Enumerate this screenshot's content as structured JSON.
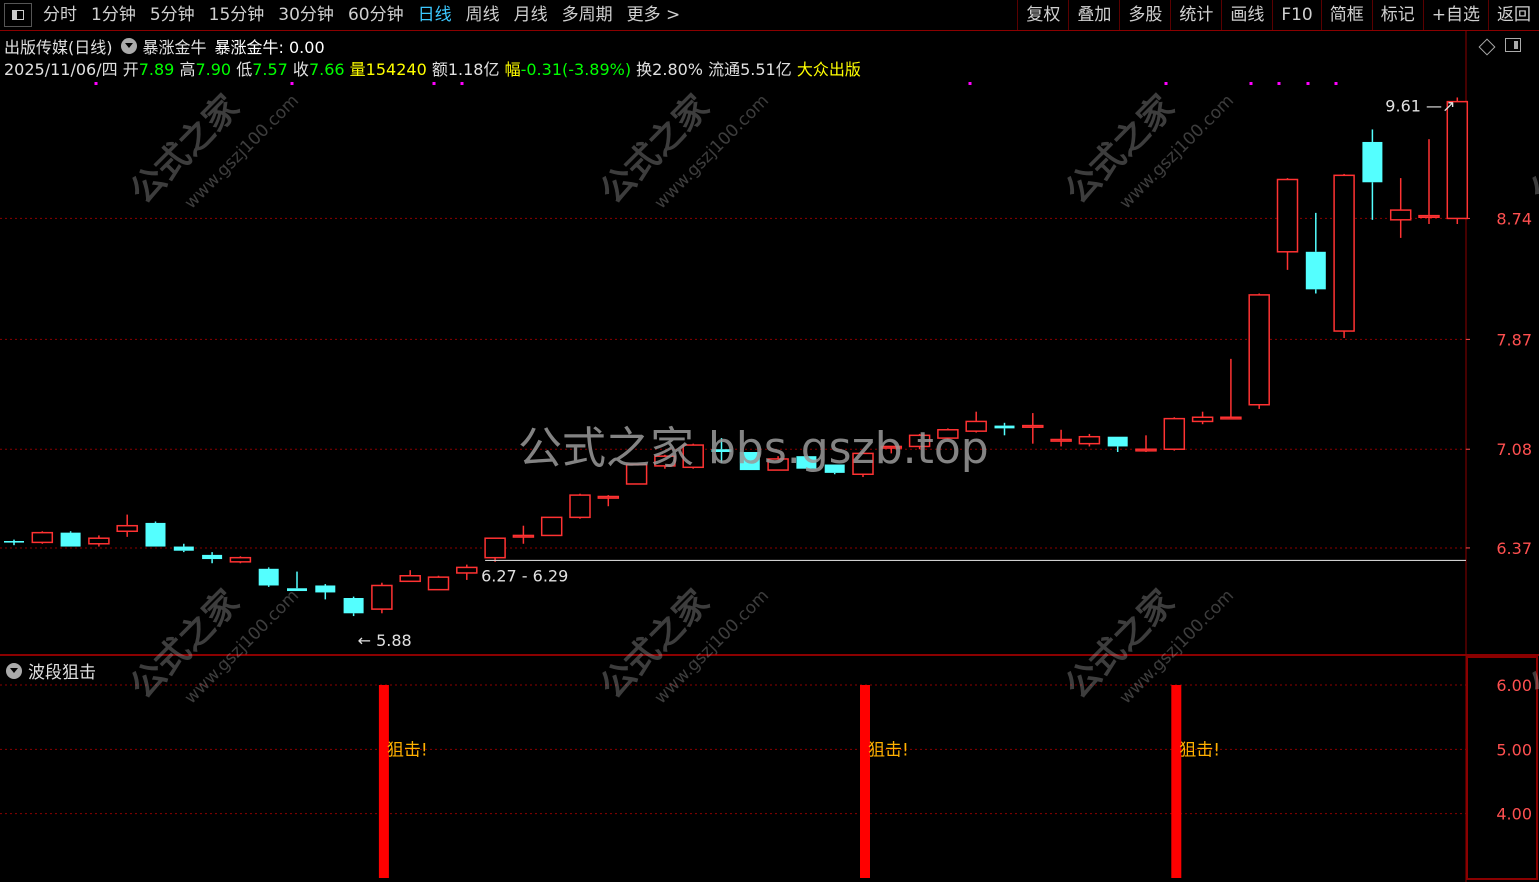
{
  "toolbar": {
    "periods": [
      "分时",
      "1分钟",
      "5分钟",
      "15分钟",
      "30分钟",
      "60分钟",
      "日线",
      "周线",
      "月线",
      "多周期",
      "更多 >"
    ],
    "active_period": "日线",
    "tools": [
      "复权",
      "叠加",
      "多股",
      "统计",
      "画线",
      "F10",
      "简框",
      "标记",
      "+自选",
      "返回"
    ]
  },
  "header": {
    "stock_title": "出版传媒(日线)",
    "indicator_name": "暴涨金牛",
    "indicator_value": "暴涨金牛: 0.00",
    "date": "2025/11/06/四",
    "open_label": "开",
    "open": "7.89",
    "high_label": "高",
    "high": "7.90",
    "low_label": "低",
    "low": "7.57",
    "close_label": "收",
    "close": "7.66",
    "vol_label": "量",
    "vol": "154240",
    "amount": "额1.18亿",
    "change_label": "幅",
    "change": "-0.31(-3.89%)",
    "turnover": "换2.80%",
    "float": "流通5.51亿",
    "sector": "大众出版"
  },
  "sub_panel": {
    "title": "波段狙击",
    "signal_text": "狙击!"
  },
  "watermark": {
    "center": "公式之家 bbs.gszb.top",
    "diag_cn": "公式之家",
    "diag_url": "www.gszj100.com"
  },
  "colors": {
    "up": "#ff3232",
    "down": "#54ffff",
    "grid": "#8b0000",
    "axis_text": "#ff5050",
    "magenta": "#ff00ff",
    "signal": "#ff0000",
    "signal_text": "#ffb000"
  },
  "chart_data": [
    {
      "type": "candlestick",
      "price_ticks": [
        8.74,
        7.87,
        7.08,
        6.37
      ],
      "ylim": [
        5.6,
        9.75
      ],
      "annotations": {
        "high": "9.61",
        "low": "5.88",
        "range_line": "6.27 - 6.29"
      },
      "candles": [
        {
          "o": 6.42,
          "h": 6.43,
          "l": 6.39,
          "c": 6.41
        },
        {
          "o": 6.41,
          "h": 6.49,
          "l": 6.4,
          "c": 6.48
        },
        {
          "o": 6.48,
          "h": 6.49,
          "l": 6.38,
          "c": 6.38
        },
        {
          "o": 6.4,
          "h": 6.46,
          "l": 6.38,
          "c": 6.44
        },
        {
          "o": 6.49,
          "h": 6.61,
          "l": 6.45,
          "c": 6.53
        },
        {
          "o": 6.55,
          "h": 6.56,
          "l": 6.38,
          "c": 6.38
        },
        {
          "o": 6.38,
          "h": 6.4,
          "l": 6.34,
          "c": 6.35
        },
        {
          "o": 6.32,
          "h": 6.34,
          "l": 6.26,
          "c": 6.29
        },
        {
          "o": 6.27,
          "h": 6.31,
          "l": 6.26,
          "c": 6.3
        },
        {
          "o": 6.22,
          "h": 6.23,
          "l": 6.09,
          "c": 6.1
        },
        {
          "o": 6.08,
          "h": 6.2,
          "l": 6.06,
          "c": 6.06
        },
        {
          "o": 6.1,
          "h": 6.11,
          "l": 6.0,
          "c": 6.05
        },
        {
          "o": 6.01,
          "h": 6.02,
          "l": 5.88,
          "c": 5.9
        },
        {
          "o": 5.93,
          "h": 6.12,
          "l": 5.9,
          "c": 6.1
        },
        {
          "o": 6.13,
          "h": 6.21,
          "l": 6.13,
          "c": 6.17
        },
        {
          "o": 6.07,
          "h": 6.17,
          "l": 6.07,
          "c": 6.16
        },
        {
          "o": 6.19,
          "h": 6.25,
          "l": 6.14,
          "c": 6.23
        },
        {
          "o": 6.3,
          "h": 6.44,
          "l": 6.27,
          "c": 6.44
        },
        {
          "o": 6.45,
          "h": 6.53,
          "l": 6.4,
          "c": 6.46
        },
        {
          "o": 6.46,
          "h": 6.59,
          "l": 6.46,
          "c": 6.59
        },
        {
          "o": 6.59,
          "h": 6.76,
          "l": 6.58,
          "c": 6.75
        },
        {
          "o": 6.73,
          "h": 6.75,
          "l": 6.67,
          "c": 6.74
        },
        {
          "o": 6.83,
          "h": 6.97,
          "l": 6.83,
          "c": 6.97
        },
        {
          "o": 6.96,
          "h": 7.04,
          "l": 6.94,
          "c": 7.03
        },
        {
          "o": 6.95,
          "h": 7.12,
          "l": 6.94,
          "c": 7.11
        },
        {
          "o": 7.08,
          "h": 7.16,
          "l": 6.98,
          "c": 7.06
        },
        {
          "o": 7.06,
          "h": 7.06,
          "l": 6.93,
          "c": 6.93
        },
        {
          "o": 6.93,
          "h": 7.03,
          "l": 6.93,
          "c": 7.01
        },
        {
          "o": 7.03,
          "h": 7.03,
          "l": 6.94,
          "c": 6.94
        },
        {
          "o": 6.97,
          "h": 6.97,
          "l": 6.9,
          "c": 6.91
        },
        {
          "o": 6.9,
          "h": 7.06,
          "l": 6.88,
          "c": 7.05
        },
        {
          "o": 7.09,
          "h": 7.1,
          "l": 7.05,
          "c": 7.1
        },
        {
          "o": 7.1,
          "h": 7.19,
          "l": 7.08,
          "c": 7.18
        },
        {
          "o": 7.16,
          "h": 7.23,
          "l": 7.15,
          "c": 7.22
        },
        {
          "o": 7.21,
          "h": 7.35,
          "l": 7.2,
          "c": 7.28
        },
        {
          "o": 7.25,
          "h": 7.27,
          "l": 7.18,
          "c": 7.23
        },
        {
          "o": 7.25,
          "h": 7.34,
          "l": 7.12,
          "c": 7.25
        },
        {
          "o": 7.15,
          "h": 7.22,
          "l": 7.1,
          "c": 7.15
        },
        {
          "o": 7.12,
          "h": 7.19,
          "l": 7.1,
          "c": 7.17
        },
        {
          "o": 7.17,
          "h": 7.17,
          "l": 7.06,
          "c": 7.1
        },
        {
          "o": 7.08,
          "h": 7.18,
          "l": 7.06,
          "c": 7.08
        },
        {
          "o": 7.08,
          "h": 7.31,
          "l": 7.07,
          "c": 7.3
        },
        {
          "o": 7.28,
          "h": 7.35,
          "l": 7.26,
          "c": 7.31
        },
        {
          "o": 7.31,
          "h": 7.73,
          "l": 7.3,
          "c": 7.31
        },
        {
          "o": 7.4,
          "h": 8.2,
          "l": 7.37,
          "c": 8.19
        },
        {
          "o": 8.5,
          "h": 9.03,
          "l": 8.37,
          "c": 9.02
        },
        {
          "o": 8.5,
          "h": 8.78,
          "l": 8.2,
          "c": 8.23
        },
        {
          "o": 7.93,
          "h": 9.06,
          "l": 7.88,
          "c": 9.05
        },
        {
          "o": 9.29,
          "h": 9.38,
          "l": 8.73,
          "c": 9.0
        },
        {
          "o": 8.73,
          "h": 9.03,
          "l": 8.6,
          "c": 8.8
        },
        {
          "o": 8.75,
          "h": 9.31,
          "l": 8.7,
          "c": 8.76
        },
        {
          "o": 8.74,
          "h": 9.61,
          "l": 8.7,
          "c": 9.58
        }
      ]
    },
    {
      "type": "bar",
      "name": "波段狙击",
      "y_ticks": [
        6.0,
        5.0,
        4.0
      ],
      "ylim": [
        3.0,
        6.0
      ],
      "signals": [
        13,
        30,
        41
      ]
    }
  ]
}
